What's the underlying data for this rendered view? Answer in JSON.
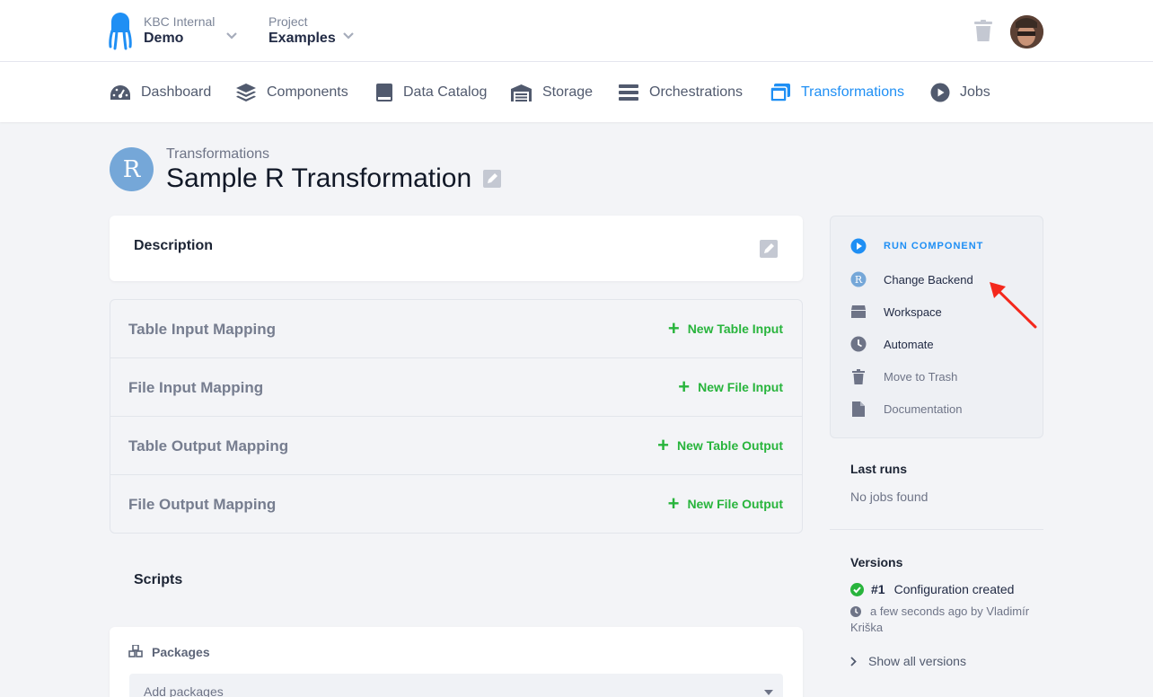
{
  "header": {
    "org_label": "KBC Internal",
    "org_value": "Demo",
    "project_label": "Project",
    "project_value": "Examples"
  },
  "nav": {
    "items": [
      {
        "label": "Dashboard",
        "icon": "dashboard-icon"
      },
      {
        "label": "Components",
        "icon": "layers-icon"
      },
      {
        "label": "Data Catalog",
        "icon": "book-icon"
      },
      {
        "label": "Storage",
        "icon": "warehouse-icon"
      },
      {
        "label": "Orchestrations",
        "icon": "bars-icon"
      },
      {
        "label": "Transformations",
        "icon": "window-icon",
        "active": true
      },
      {
        "label": "Jobs",
        "icon": "play-icon"
      }
    ]
  },
  "page": {
    "breadcrumb": "Transformations",
    "title": "Sample R Transformation",
    "logo_letter": "R"
  },
  "description": {
    "heading": "Description"
  },
  "mappings": [
    {
      "label": "Table Input Mapping",
      "action": "New Table Input"
    },
    {
      "label": "File Input Mapping",
      "action": "New File Input"
    },
    {
      "label": "Table Output Mapping",
      "action": "New Table Output"
    },
    {
      "label": "File Output Mapping",
      "action": "New File Output"
    }
  ],
  "scripts": {
    "heading": "Scripts",
    "packages_heading": "Packages",
    "packages_placeholder": "Add packages"
  },
  "sidebar": {
    "actions": [
      {
        "label": "RUN COMPONENT",
        "icon": "play-circle-icon"
      },
      {
        "label": "Change Backend",
        "icon": "r-logo-icon"
      },
      {
        "label": "Workspace",
        "icon": "box-icon"
      },
      {
        "label": "Automate",
        "icon": "clock-icon"
      },
      {
        "label": "Move to Trash",
        "icon": "trash-icon"
      },
      {
        "label": "Documentation",
        "icon": "file-icon"
      }
    ],
    "last_runs_heading": "Last runs",
    "last_runs_empty": "No jobs found",
    "versions_heading": "Versions",
    "version_number": "#1",
    "version_desc": "Configuration created",
    "version_meta": "a few seconds ago by Vladimír Kriška",
    "show_all": "Show all versions"
  },
  "colors": {
    "accent": "#1f8ff4",
    "success": "#28b43c",
    "annotation_arrow": "#f4281c"
  }
}
